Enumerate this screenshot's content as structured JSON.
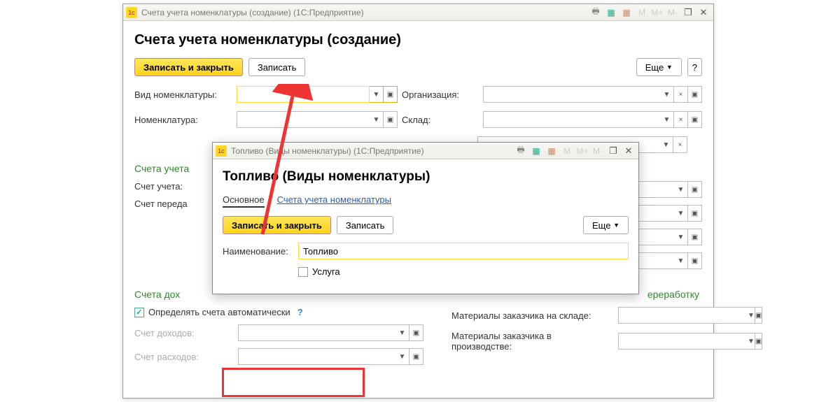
{
  "main_window": {
    "title": "Счета учета номенклатуры (создание)  (1С:Предприятие)",
    "page_title": "Счета учета номенклатуры (создание)",
    "toolbar": {
      "save_close": "Записать и закрыть",
      "save": "Записать",
      "more": "Еще",
      "help": "?"
    },
    "fields": {
      "kind_label": "Вид номенклатуры:",
      "org_label": "Организация:",
      "nom_label": "Номенклатура:",
      "warehouse_label": "Склад:"
    },
    "section_accounts": "Счета учета",
    "account_label": "Счет учета:",
    "transfer_label": "Счет переда",
    "section_income": "Счета дох",
    "auto_accounts_label": "Определять счета автоматически",
    "income_acct_label": "Счет доходов:",
    "expense_acct_label": "Счет расходов:",
    "right_truncated": "ереработку",
    "customer_stock_label": "Материалы заказчика на складе:",
    "customer_prod_label": "Материалы заказчика в производстве:"
  },
  "popup": {
    "title": "Топливо (Виды номенклатуры)  (1С:Предприятие)",
    "page_title": "Топливо (Виды номенклатуры)",
    "tabs": {
      "main": "Основное",
      "accounts": "Счета учета номенклатуры"
    },
    "toolbar": {
      "save_close": "Записать и закрыть",
      "save": "Записать",
      "more": "Еще"
    },
    "name_label": "Наименование:",
    "name_value": "Топливо",
    "service_label": "Услуга"
  },
  "titlebar_btns": {
    "m": "M",
    "mplus": "M+",
    "mminus": "M-"
  }
}
